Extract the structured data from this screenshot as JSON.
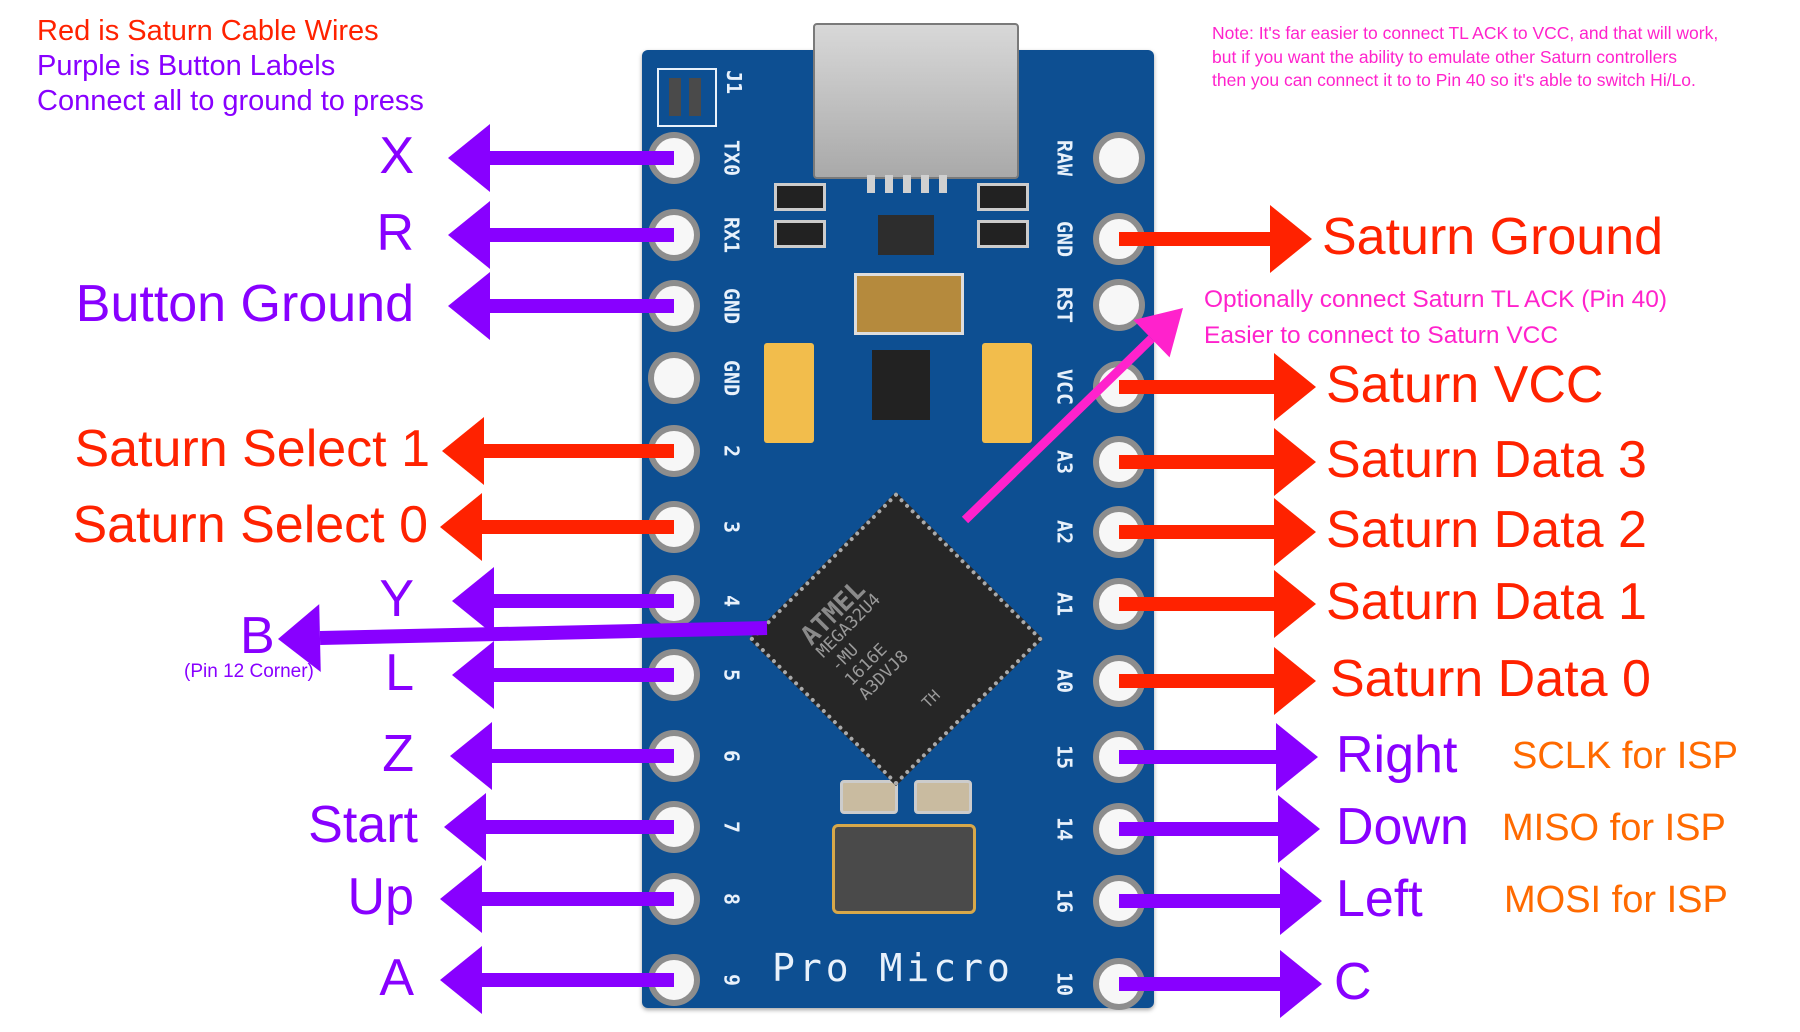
{
  "legend": {
    "line1": "Red is Saturn Cable Wires",
    "line2": "Purple is Button Labels",
    "line3": "Connect all to ground to press"
  },
  "note": {
    "line1": "Note: It's far easier to connect TL ACK to VCC, and that will work,",
    "line2": "but if you want the ability to emulate other Saturn controllers",
    "line3": "then you can connect it to to Pin 40 so it's able to switch Hi/Lo."
  },
  "colors": {
    "saturn_wire": "#ff2200",
    "button": "#8800ff",
    "note": "#ff22cc",
    "isp": "#ff6a00",
    "board": "#0d4f92"
  },
  "left_pins": [
    {
      "pin": "TX0",
      "label": "X",
      "kind": "button"
    },
    {
      "pin": "RX1",
      "label": "R",
      "kind": "button"
    },
    {
      "pin": "GND",
      "label": "Button Ground",
      "kind": "button"
    },
    {
      "pin": "GND",
      "label": "",
      "kind": "none"
    },
    {
      "pin": "2",
      "label": "Saturn Select 1",
      "kind": "saturn"
    },
    {
      "pin": "3",
      "label": "Saturn Select 0",
      "kind": "saturn"
    },
    {
      "pin": "4",
      "label": "Y",
      "kind": "button"
    },
    {
      "pin": "5",
      "label": "L",
      "kind": "button"
    },
    {
      "pin": "6",
      "label": "Z",
      "kind": "button"
    },
    {
      "pin": "7",
      "label": "Start",
      "kind": "button"
    },
    {
      "pin": "8",
      "label": "Up",
      "kind": "button"
    },
    {
      "pin": "9",
      "label": "A",
      "kind": "button"
    }
  ],
  "right_pins": [
    {
      "pin": "RAW",
      "label": "",
      "kind": "none",
      "isp": ""
    },
    {
      "pin": "GND",
      "label": "Saturn Ground",
      "kind": "saturn",
      "isp": ""
    },
    {
      "pin": "RST",
      "label": "",
      "kind": "none",
      "isp": ""
    },
    {
      "pin": "VCC",
      "label": "Saturn VCC",
      "kind": "saturn",
      "isp": ""
    },
    {
      "pin": "A3",
      "label": "Saturn Data 3",
      "kind": "saturn",
      "isp": ""
    },
    {
      "pin": "A2",
      "label": "Saturn Data 2",
      "kind": "saturn",
      "isp": ""
    },
    {
      "pin": "A1",
      "label": "Saturn Data 1",
      "kind": "saturn",
      "isp": ""
    },
    {
      "pin": "A0",
      "label": "Saturn Data 0",
      "kind": "saturn",
      "isp": ""
    },
    {
      "pin": "15",
      "label": "Right",
      "kind": "button",
      "isp": "SCLK for ISP"
    },
    {
      "pin": "14",
      "label": "Down",
      "kind": "button",
      "isp": "MISO for ISP"
    },
    {
      "pin": "16",
      "label": "Left",
      "kind": "button",
      "isp": "MOSI for ISP"
    },
    {
      "pin": "10",
      "label": "C",
      "kind": "button",
      "isp": ""
    }
  ],
  "chip_pin": {
    "label": "B",
    "sublabel": "(Pin 12 Corner)"
  },
  "tl_ack": {
    "line1": "Optionally connect Saturn TL ACK (Pin 40)",
    "line2": "Easier to connect to Saturn VCC"
  },
  "board": {
    "name": "Pro Micro",
    "jumper": "J1",
    "chip_lines": [
      "MEGA32U4",
      "-MU",
      "1616E",
      "A3DVJ8"
    ],
    "chip_brand": "ATMEL",
    "chip_mark": "TH"
  }
}
